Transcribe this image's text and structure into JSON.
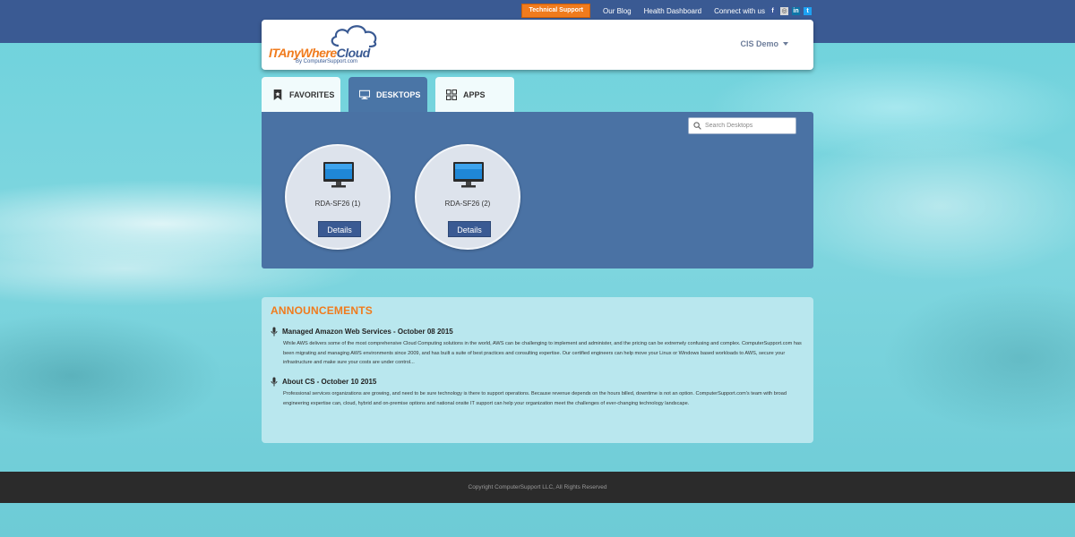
{
  "topbar": {
    "tech_support": "Technical Support",
    "links": [
      "Our Blog",
      "Health Dashboard"
    ],
    "connect_label": "Connect with us"
  },
  "header": {
    "logo_prefix": "ITAnyWhere",
    "logo_suffix": "Cloud",
    "logo_sub": "By ComputerSupport.com",
    "user": "CIS Demo"
  },
  "tabs": [
    {
      "label": "FAVORITES",
      "icon": "bookmark-icon"
    },
    {
      "label": "DESKTOPS",
      "icon": "monitor-icon",
      "active": true
    },
    {
      "label": "APPS",
      "icon": "grid-icon"
    }
  ],
  "search": {
    "placeholder": "Search Desktops"
  },
  "desktops": [
    {
      "name": "RDA-SF26 (1)",
      "button": "Details"
    },
    {
      "name": "RDA-SF26 (2)",
      "button": "Details"
    }
  ],
  "announcements": {
    "title": "ANNOUNCEMENTS",
    "items": [
      {
        "title": "Managed Amazon Web Services - October 08 2015",
        "body": "While AWS delivers some of the most comprehensive Cloud Computing solutions in the world, AWS can be challenging to implement and administer, and the pricing can be extremely confusing and complex. ComputerSupport.com has been migrating and managing AWS environments since 2009, and has built a suite of best practices and consulting expertise. Our certified engineers can help move your Linux or Windows based workloads to AWS, secure your infrastructure and make sure your costs are under control..."
      },
      {
        "title": "About CS - October 10 2015",
        "body": "Professional services organizations are growing, and need to be sure technology is there to support operations. Because revenue depends on the hours billed, downtime is not an option. ComputerSupport.com's team with broad engineering expertise can, cloud, hybrid and on-premise options and national onsite IT support can help your organization meet the challenges of ever-changing technology landscape."
      }
    ]
  },
  "footer": {
    "copyright": "Copyright ComputerSupport LLC, All Rights Reserved"
  }
}
